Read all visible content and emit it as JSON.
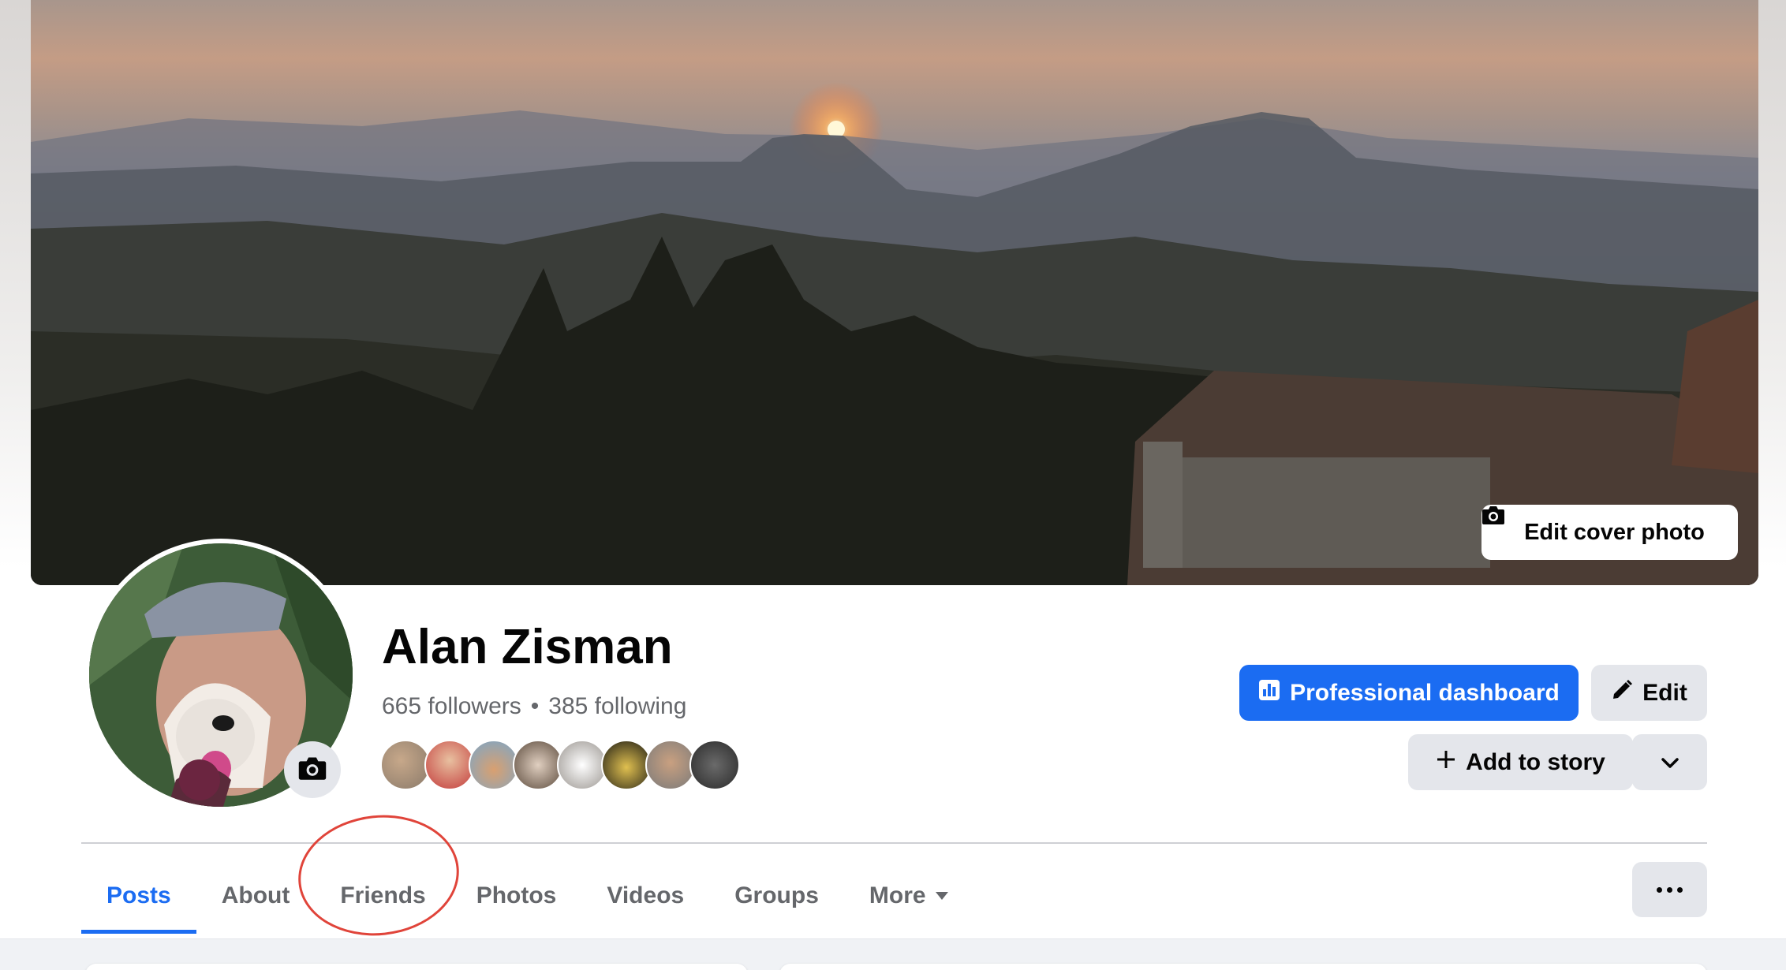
{
  "profile": {
    "name": "Alan Zisman",
    "followers": "665 followers",
    "separator": "•",
    "following": "385 following"
  },
  "cover": {
    "edit_label": "Edit cover photo"
  },
  "actions": {
    "dashboard_label": "Professional dashboard",
    "edit_label": "Edit",
    "add_story_label": "Add to story"
  },
  "tabs": [
    {
      "label": "Posts",
      "active": true
    },
    {
      "label": "About"
    },
    {
      "label": "Friends"
    },
    {
      "label": "Photos"
    },
    {
      "label": "Videos"
    },
    {
      "label": "Groups"
    },
    {
      "label": "More"
    }
  ],
  "friend_faces": [
    "#8a7a6a",
    "#c43c3c",
    "#b8865a",
    "#5b4a3c",
    "#d6d2cc",
    "#2b2a22",
    "#9a9a9a",
    "#3a3a3a"
  ],
  "colors": {
    "accent": "#1b6cf2",
    "annotation": "#e0443a",
    "secondary_button": "#e4e6eb"
  },
  "icons": {
    "cover_camera": "camera-icon",
    "avatar_camera": "camera-icon",
    "dashboard": "bar-chart-icon",
    "edit": "pencil-icon",
    "add_story": "plus-icon",
    "expand": "chevron-down-icon",
    "more_options": "more-horizontal-icon"
  }
}
